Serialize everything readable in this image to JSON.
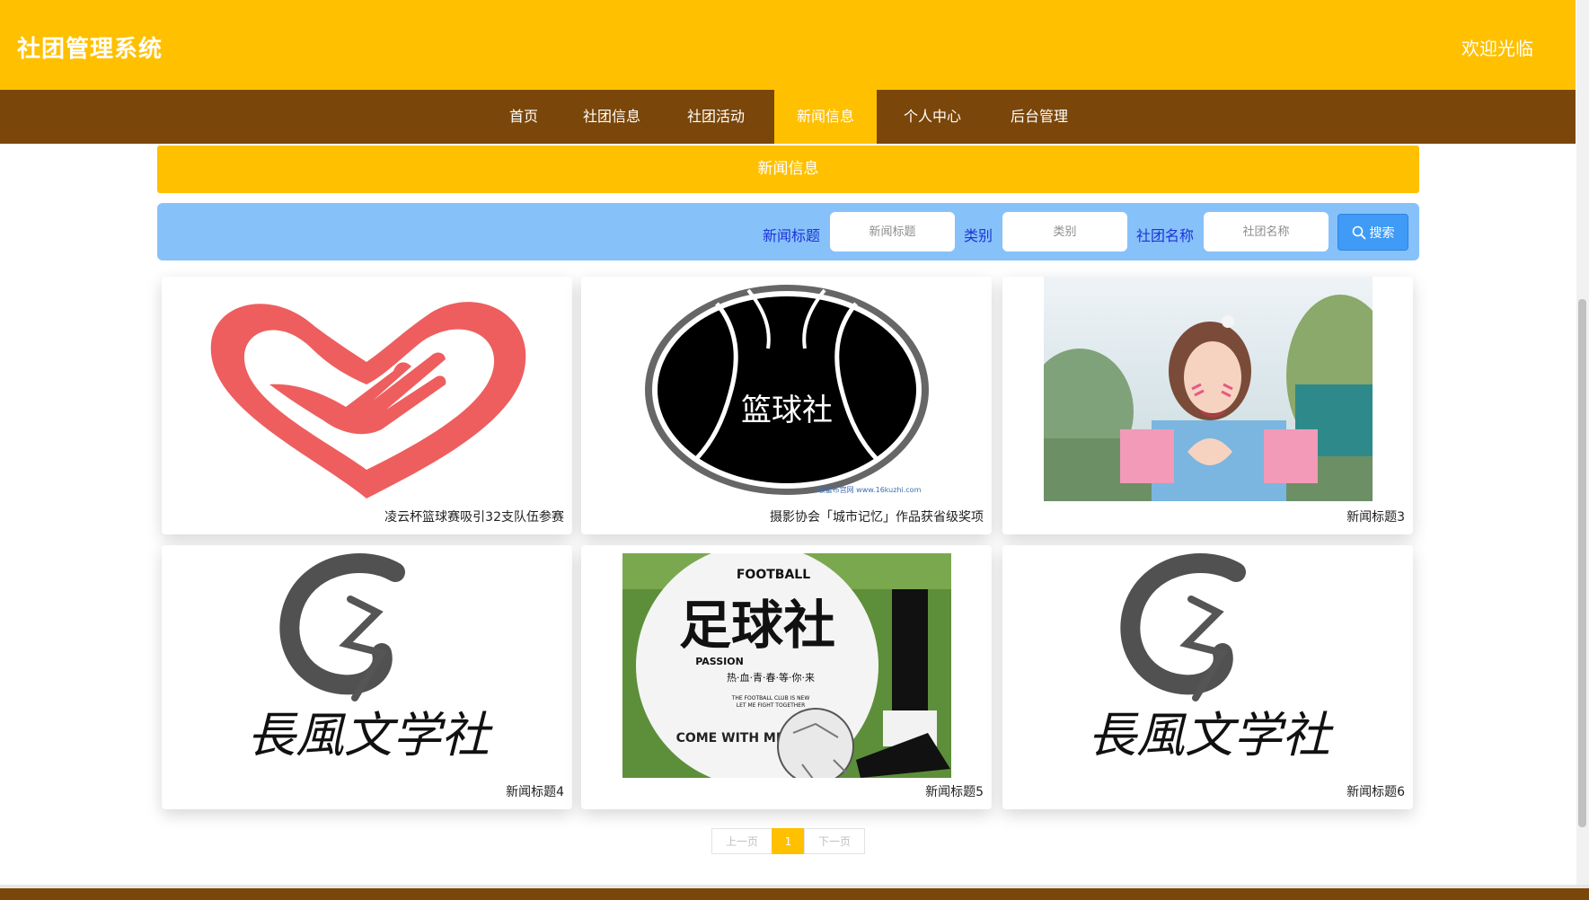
{
  "header": {
    "title": "社团管理系统",
    "welcome": "欢迎光临"
  },
  "nav": {
    "items": [
      {
        "label": "首页"
      },
      {
        "label": "社团信息"
      },
      {
        "label": "社团活动"
      },
      {
        "label": "新闻信息"
      },
      {
        "label": "个人中心"
      },
      {
        "label": "后台管理"
      }
    ],
    "active_index": 3
  },
  "section": {
    "title": "新闻信息"
  },
  "search": {
    "fields": [
      {
        "label": "新闻标题",
        "placeholder": "新闻标题"
      },
      {
        "label": "类别",
        "placeholder": "类别"
      },
      {
        "label": "社团名称",
        "placeholder": "社团名称"
      }
    ],
    "button_label": "搜索"
  },
  "news": [
    {
      "title": "凌云杯篮球赛吸引32支队伍参赛",
      "image": "heart-hand-logo"
    },
    {
      "title": "摄影协会「城市记忆」作品获省级奖项",
      "image": "basketball-club-logo",
      "image_text": "篮球社",
      "image_caption": "敏富布宫网 www.16kuzhi.com"
    },
    {
      "title": "新闻标题3",
      "image": "cosplay-photo"
    },
    {
      "title": "新闻标题4",
      "image": "literature-club-logo",
      "image_text": "長風文学社"
    },
    {
      "title": "新闻标题5",
      "image": "football-club-poster",
      "image_text": "足球社",
      "image_lines": [
        "FOOTBALL",
        "PASSION",
        "热·血·青·春·等·你·来",
        "THE FOOTBALL CLUB IS NEW",
        "LET ME FIGHT TOGETHER",
        "COME WITH ME"
      ]
    },
    {
      "title": "新闻标题6",
      "image": "literature-club-logo",
      "image_text": "長風文学社"
    }
  ],
  "pagination": {
    "prev": "上一页",
    "current": "1",
    "next": "下一页"
  },
  "colors": {
    "primary": "#FFC000",
    "nav": "#7A4609",
    "search_bg": "#87C1FA",
    "label": "#1b34d6",
    "button": "#3F9BF5"
  }
}
